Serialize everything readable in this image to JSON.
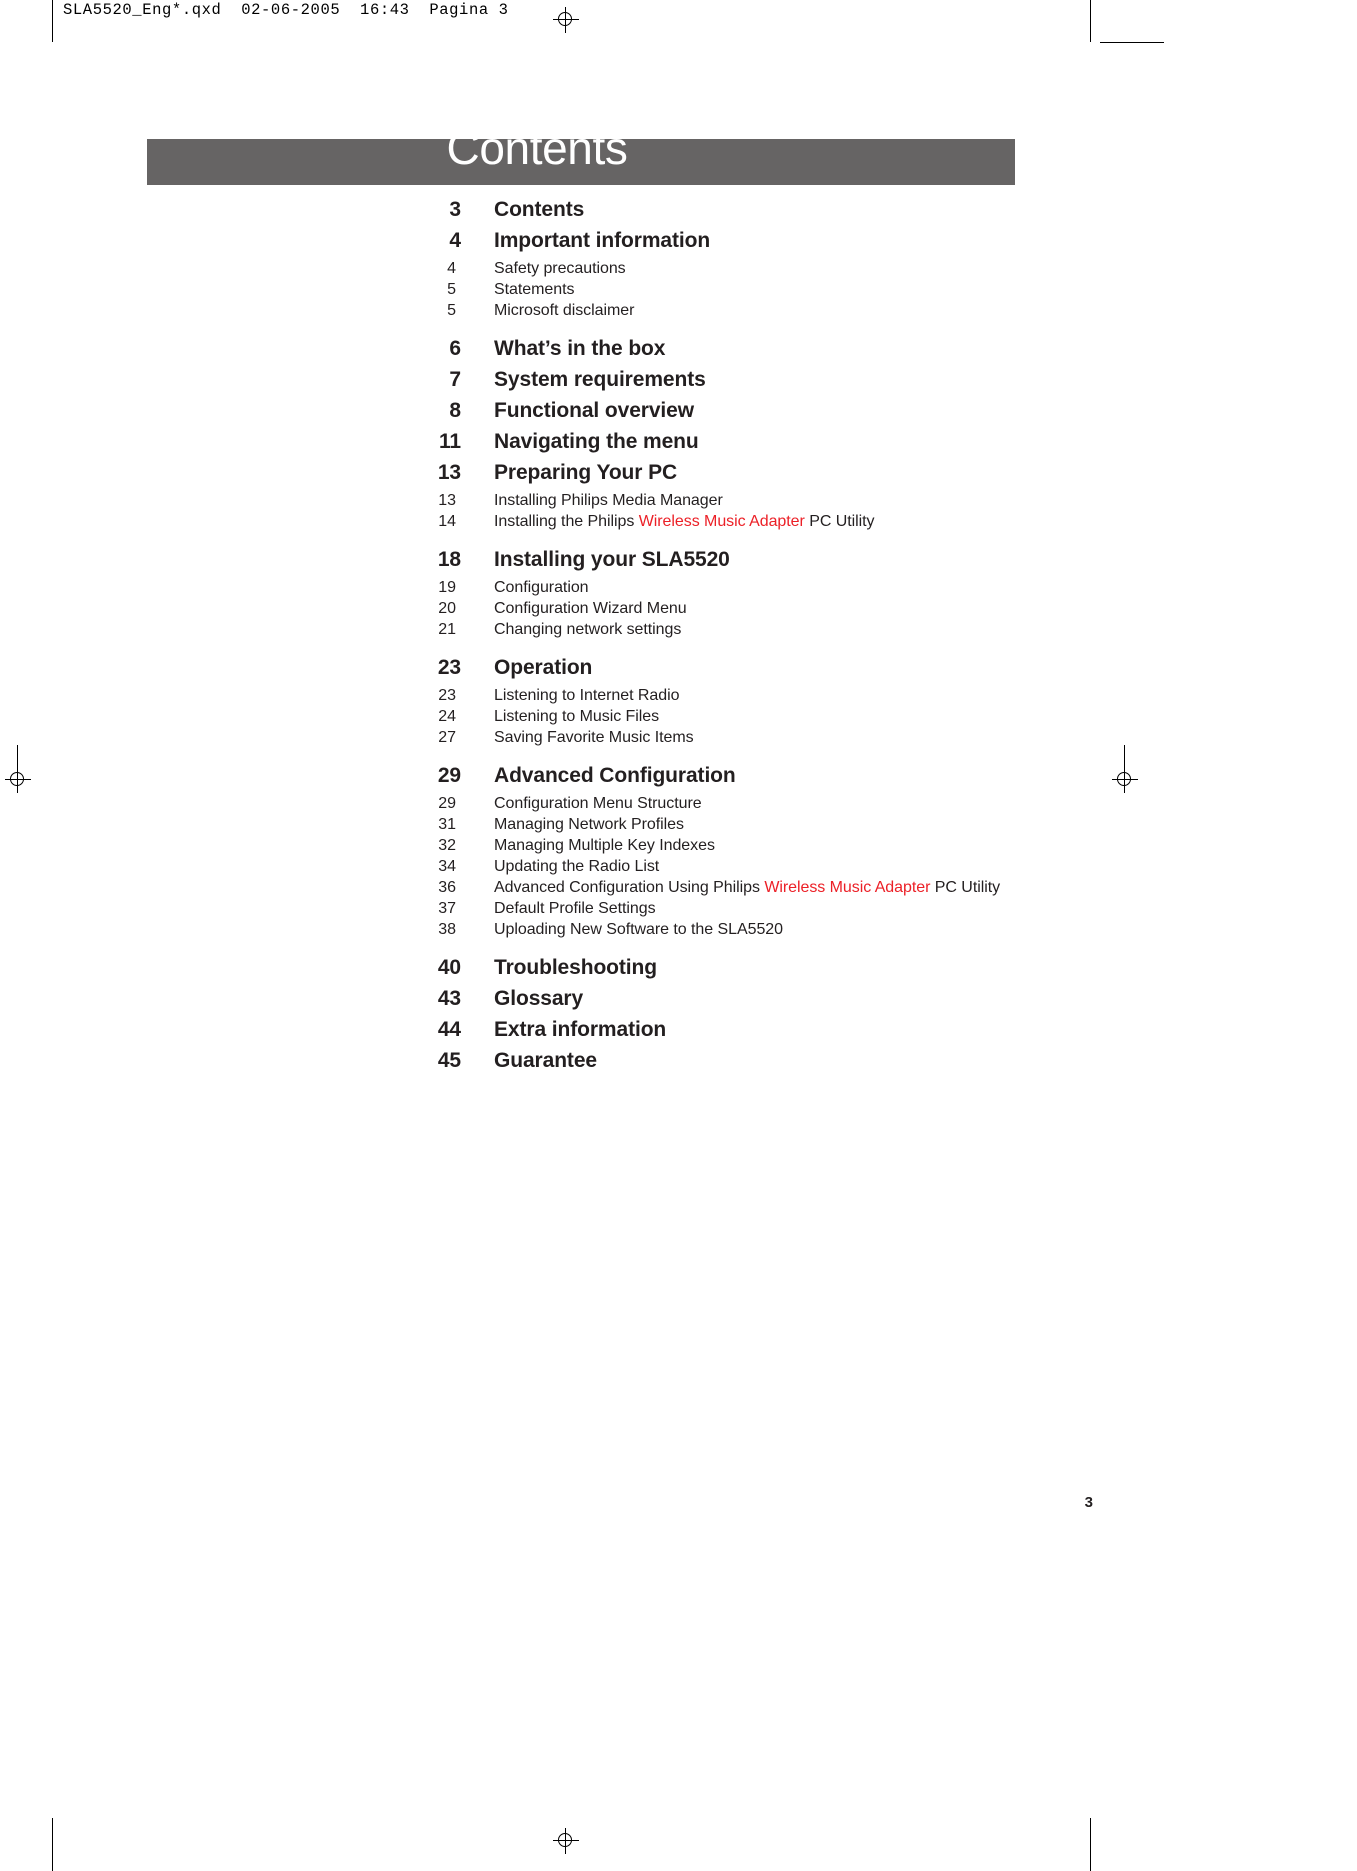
{
  "proof_header": {
    "filename": "SLA5520_Eng*.qxd  02-06-2005  16:43  Pagina 3"
  },
  "banner": {
    "title": "Contents"
  },
  "colors": {
    "banner_background": "#666464",
    "banner_text": "#ffffff",
    "body_text": "#231f20",
    "accent_red": "#ec2027",
    "page_background": "#ffffff"
  },
  "toc": {
    "entries": [
      {
        "type": "main",
        "page": "3",
        "label": "Contents"
      },
      {
        "type": "main",
        "page": "4",
        "label": "Important information"
      },
      {
        "type": "sub",
        "page": "4",
        "label": "Safety precautions"
      },
      {
        "type": "sub",
        "page": "5",
        "label": "Statements"
      },
      {
        "type": "sub",
        "page": "5",
        "label": "Microsoft disclaimer"
      },
      {
        "type": "main",
        "page": "6",
        "label": "What’s in the box"
      },
      {
        "type": "main",
        "page": "7",
        "label": "System requirements"
      },
      {
        "type": "main",
        "page": "8",
        "label": "Functional overview"
      },
      {
        "type": "main",
        "page": "11",
        "label": "Navigating the menu"
      },
      {
        "type": "main",
        "page": "13",
        "label": "Preparing Your PC"
      },
      {
        "type": "sub",
        "page": "13",
        "label": "Installing Philips Media Manager"
      },
      {
        "type": "sub",
        "page": "14",
        "label_pre": "Installing the Philips ",
        "label_accent": "Wireless Music Adapter",
        "label_post": " PC Utility"
      },
      {
        "type": "main",
        "page": "18",
        "label": "Installing your SLA5520"
      },
      {
        "type": "sub",
        "page": "19",
        "label": "Configuration"
      },
      {
        "type": "sub",
        "page": "20",
        "label": "Configuration Wizard Menu"
      },
      {
        "type": "sub",
        "page": "21",
        "label": "Changing network settings"
      },
      {
        "type": "main",
        "page": "23",
        "label": "Operation"
      },
      {
        "type": "sub",
        "page": "23",
        "label": "Listening to Internet Radio"
      },
      {
        "type": "sub",
        "page": "24",
        "label": "Listening to Music Files"
      },
      {
        "type": "sub",
        "page": "27",
        "label": "Saving Favorite Music Items"
      },
      {
        "type": "main",
        "page": "29",
        "label": "Advanced Configuration"
      },
      {
        "type": "sub",
        "page": "29",
        "label": "Configuration Menu Structure"
      },
      {
        "type": "sub",
        "page": "31",
        "label": "Managing Network Profiles"
      },
      {
        "type": "sub",
        "page": "32",
        "label": "Managing Multiple Key Indexes"
      },
      {
        "type": "sub",
        "page": "34",
        "label": "Updating the Radio List"
      },
      {
        "type": "sub",
        "page": "36",
        "label_pre": "Advanced Configuration Using Philips ",
        "label_accent": "Wireless Music Adapter",
        "label_post": " PC Utility"
      },
      {
        "type": "sub",
        "page": "37",
        "label": "Default Profile Settings"
      },
      {
        "type": "sub",
        "page": "38",
        "label": "Uploading New Software to the SLA5520"
      },
      {
        "type": "main",
        "page": "40",
        "label": "Troubleshooting"
      },
      {
        "type": "main",
        "page": "43",
        "label": "Glossary"
      },
      {
        "type": "main",
        "page": "44",
        "label": "Extra information"
      },
      {
        "type": "main",
        "page": "45",
        "label": "Guarantee"
      }
    ]
  },
  "folio": {
    "page_number": "3"
  }
}
